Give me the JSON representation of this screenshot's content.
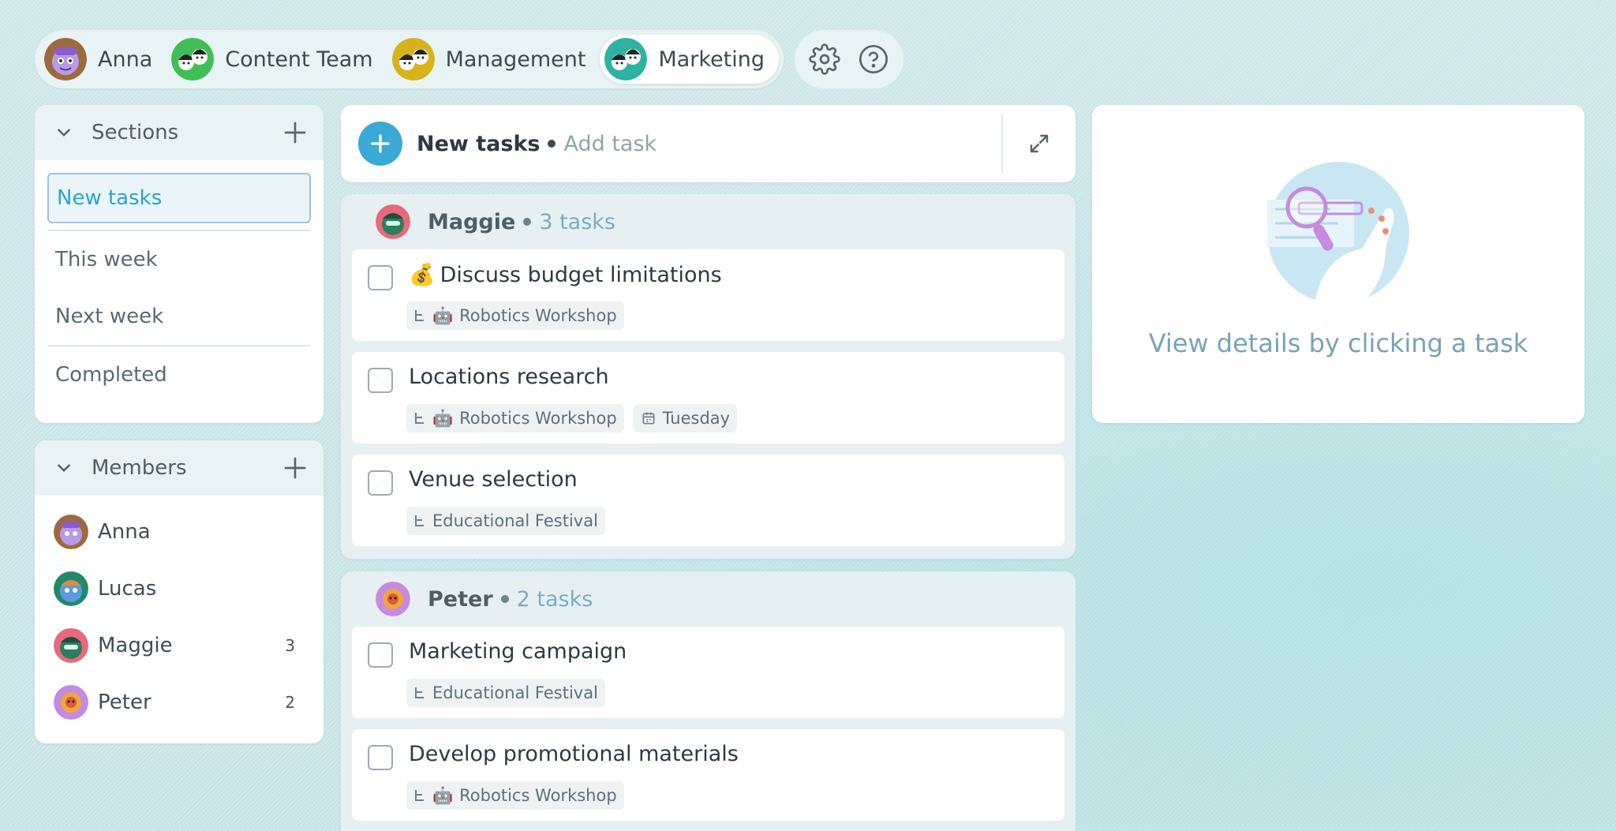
{
  "teams": [
    {
      "label": "Anna",
      "active": false
    },
    {
      "label": "Content Team",
      "active": false
    },
    {
      "label": "Management",
      "active": false
    },
    {
      "label": "Marketing",
      "active": true
    }
  ],
  "utility": {
    "settings": "gear-icon",
    "help": "help-icon"
  },
  "sections": {
    "title": "Sections",
    "items": [
      "New tasks",
      "This week",
      "Next week",
      "Completed"
    ]
  },
  "members": {
    "title": "Members",
    "items": [
      {
        "name": "Anna",
        "count": ""
      },
      {
        "name": "Lucas",
        "count": ""
      },
      {
        "name": "Maggie",
        "count": "3"
      },
      {
        "name": "Peter",
        "count": "2"
      }
    ]
  },
  "new_tasks": {
    "title": "New tasks",
    "add_placeholder": "Add task"
  },
  "groups": [
    {
      "name": "Maggie",
      "count_label": "3 tasks",
      "tasks": [
        {
          "emoji": "💰",
          "title": "Discuss budget limitations",
          "project_emoji": "🤖",
          "project": "Robotics Workshop",
          "due": ""
        },
        {
          "emoji": "",
          "title": "Locations research",
          "project_emoji": "🤖",
          "project": "Robotics Workshop",
          "due": "Tuesday"
        },
        {
          "emoji": "",
          "title": "Venue selection",
          "project_emoji": "",
          "project": "Educational Festival",
          "due": ""
        }
      ]
    },
    {
      "name": "Peter",
      "count_label": "2 tasks",
      "tasks": [
        {
          "emoji": "",
          "title": "Marketing campaign",
          "project_emoji": "",
          "project": "Educational Festival",
          "due": ""
        },
        {
          "emoji": "",
          "title": "Develop promotional materials",
          "project_emoji": "🤖",
          "project": "Robotics Workshop",
          "due": ""
        }
      ]
    }
  ],
  "detail": {
    "message": "View details by clicking a task"
  },
  "colors": {
    "accent": "#3aa9d6",
    "active_section_text": "#2da3cf",
    "count_text": "#79adc4"
  }
}
